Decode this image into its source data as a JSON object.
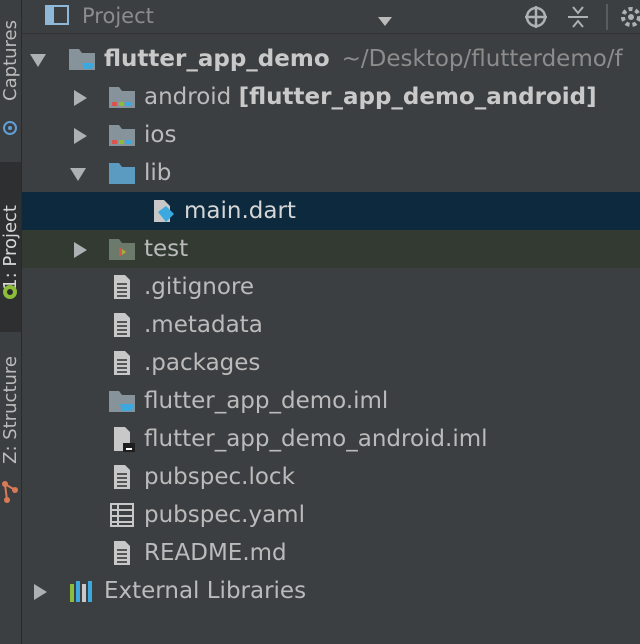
{
  "sidebar": {
    "captures": "Captures",
    "project": "1: Project",
    "structure": "Z: Structure"
  },
  "toolbar": {
    "title": "Project"
  },
  "tree": {
    "root": {
      "name": "flutter_app_demo",
      "path": "~/Desktop/flutterdemo/f"
    },
    "android": {
      "name": "android",
      "module": "[flutter_app_demo_android]"
    },
    "ios": "ios",
    "lib": "lib",
    "main_dart": "main.dart",
    "test": "test",
    "gitignore": ".gitignore",
    "metadata": ".metadata",
    "packages": ".packages",
    "iml": "flutter_app_demo.iml",
    "android_iml": "flutter_app_demo_android.iml",
    "pubspec_lock": "pubspec.lock",
    "pubspec_yaml": "pubspec.yaml",
    "readme": "README.md",
    "external": "External Libraries"
  },
  "colors": {
    "background": "#3c3f41",
    "selection": "#0d293e",
    "folder": "#87939a",
    "flutter_blue": "#3ba9e0"
  }
}
